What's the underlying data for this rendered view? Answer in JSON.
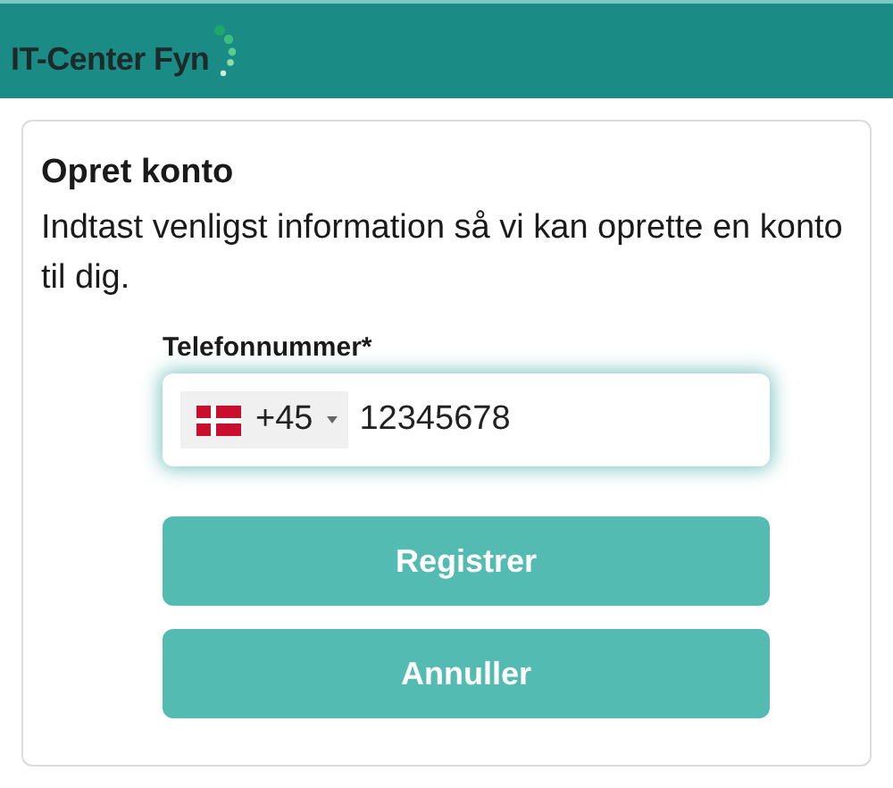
{
  "header": {
    "logo_text": "IT-Center Fyn"
  },
  "card": {
    "title": "Opret konto",
    "intro": "Indtast venligst information så vi kan oprette en konto til dig."
  },
  "phone": {
    "label": "Telefonnummer*",
    "country_code": "+45",
    "value": "12345678"
  },
  "buttons": [
    "Registrer",
    "Annuller"
  ]
}
